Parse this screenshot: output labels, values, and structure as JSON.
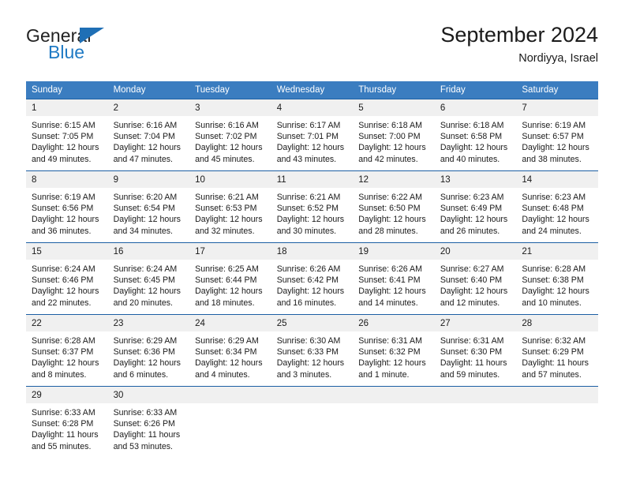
{
  "logo": {
    "word_one": "General",
    "word_two": "Blue",
    "triangle_color": "#1f6fb5",
    "blue_color": "#1f7ac4"
  },
  "header": {
    "title": "September 2024",
    "location": "Nordiyya, Israel"
  },
  "theme": {
    "header_row_bg": "#3b7dc0",
    "week_separator": "#1c5fa4",
    "daynum_bg": "#f0f0f0",
    "page_bg": "#ffffff"
  },
  "weekday_headers": [
    "Sunday",
    "Monday",
    "Tuesday",
    "Wednesday",
    "Thursday",
    "Friday",
    "Saturday"
  ],
  "labels": {
    "sunrise_prefix": "Sunrise:",
    "sunset_prefix": "Sunset:",
    "daylight_prefix": "Daylight:"
  },
  "weeks": [
    [
      {
        "day": "1",
        "sunrise": "Sunrise: 6:15 AM",
        "sunset": "Sunset: 7:05 PM",
        "daylight_line1": "Daylight: 12 hours",
        "daylight_line2": "and 49 minutes."
      },
      {
        "day": "2",
        "sunrise": "Sunrise: 6:16 AM",
        "sunset": "Sunset: 7:04 PM",
        "daylight_line1": "Daylight: 12 hours",
        "daylight_line2": "and 47 minutes."
      },
      {
        "day": "3",
        "sunrise": "Sunrise: 6:16 AM",
        "sunset": "Sunset: 7:02 PM",
        "daylight_line1": "Daylight: 12 hours",
        "daylight_line2": "and 45 minutes."
      },
      {
        "day": "4",
        "sunrise": "Sunrise: 6:17 AM",
        "sunset": "Sunset: 7:01 PM",
        "daylight_line1": "Daylight: 12 hours",
        "daylight_line2": "and 43 minutes."
      },
      {
        "day": "5",
        "sunrise": "Sunrise: 6:18 AM",
        "sunset": "Sunset: 7:00 PM",
        "daylight_line1": "Daylight: 12 hours",
        "daylight_line2": "and 42 minutes."
      },
      {
        "day": "6",
        "sunrise": "Sunrise: 6:18 AM",
        "sunset": "Sunset: 6:58 PM",
        "daylight_line1": "Daylight: 12 hours",
        "daylight_line2": "and 40 minutes."
      },
      {
        "day": "7",
        "sunrise": "Sunrise: 6:19 AM",
        "sunset": "Sunset: 6:57 PM",
        "daylight_line1": "Daylight: 12 hours",
        "daylight_line2": "and 38 minutes."
      }
    ],
    [
      {
        "day": "8",
        "sunrise": "Sunrise: 6:19 AM",
        "sunset": "Sunset: 6:56 PM",
        "daylight_line1": "Daylight: 12 hours",
        "daylight_line2": "and 36 minutes."
      },
      {
        "day": "9",
        "sunrise": "Sunrise: 6:20 AM",
        "sunset": "Sunset: 6:54 PM",
        "daylight_line1": "Daylight: 12 hours",
        "daylight_line2": "and 34 minutes."
      },
      {
        "day": "10",
        "sunrise": "Sunrise: 6:21 AM",
        "sunset": "Sunset: 6:53 PM",
        "daylight_line1": "Daylight: 12 hours",
        "daylight_line2": "and 32 minutes."
      },
      {
        "day": "11",
        "sunrise": "Sunrise: 6:21 AM",
        "sunset": "Sunset: 6:52 PM",
        "daylight_line1": "Daylight: 12 hours",
        "daylight_line2": "and 30 minutes."
      },
      {
        "day": "12",
        "sunrise": "Sunrise: 6:22 AM",
        "sunset": "Sunset: 6:50 PM",
        "daylight_line1": "Daylight: 12 hours",
        "daylight_line2": "and 28 minutes."
      },
      {
        "day": "13",
        "sunrise": "Sunrise: 6:23 AM",
        "sunset": "Sunset: 6:49 PM",
        "daylight_line1": "Daylight: 12 hours",
        "daylight_line2": "and 26 minutes."
      },
      {
        "day": "14",
        "sunrise": "Sunrise: 6:23 AM",
        "sunset": "Sunset: 6:48 PM",
        "daylight_line1": "Daylight: 12 hours",
        "daylight_line2": "and 24 minutes."
      }
    ],
    [
      {
        "day": "15",
        "sunrise": "Sunrise: 6:24 AM",
        "sunset": "Sunset: 6:46 PM",
        "daylight_line1": "Daylight: 12 hours",
        "daylight_line2": "and 22 minutes."
      },
      {
        "day": "16",
        "sunrise": "Sunrise: 6:24 AM",
        "sunset": "Sunset: 6:45 PM",
        "daylight_line1": "Daylight: 12 hours",
        "daylight_line2": "and 20 minutes."
      },
      {
        "day": "17",
        "sunrise": "Sunrise: 6:25 AM",
        "sunset": "Sunset: 6:44 PM",
        "daylight_line1": "Daylight: 12 hours",
        "daylight_line2": "and 18 minutes."
      },
      {
        "day": "18",
        "sunrise": "Sunrise: 6:26 AM",
        "sunset": "Sunset: 6:42 PM",
        "daylight_line1": "Daylight: 12 hours",
        "daylight_line2": "and 16 minutes."
      },
      {
        "day": "19",
        "sunrise": "Sunrise: 6:26 AM",
        "sunset": "Sunset: 6:41 PM",
        "daylight_line1": "Daylight: 12 hours",
        "daylight_line2": "and 14 minutes."
      },
      {
        "day": "20",
        "sunrise": "Sunrise: 6:27 AM",
        "sunset": "Sunset: 6:40 PM",
        "daylight_line1": "Daylight: 12 hours",
        "daylight_line2": "and 12 minutes."
      },
      {
        "day": "21",
        "sunrise": "Sunrise: 6:28 AM",
        "sunset": "Sunset: 6:38 PM",
        "daylight_line1": "Daylight: 12 hours",
        "daylight_line2": "and 10 minutes."
      }
    ],
    [
      {
        "day": "22",
        "sunrise": "Sunrise: 6:28 AM",
        "sunset": "Sunset: 6:37 PM",
        "daylight_line1": "Daylight: 12 hours",
        "daylight_line2": "and 8 minutes."
      },
      {
        "day": "23",
        "sunrise": "Sunrise: 6:29 AM",
        "sunset": "Sunset: 6:36 PM",
        "daylight_line1": "Daylight: 12 hours",
        "daylight_line2": "and 6 minutes."
      },
      {
        "day": "24",
        "sunrise": "Sunrise: 6:29 AM",
        "sunset": "Sunset: 6:34 PM",
        "daylight_line1": "Daylight: 12 hours",
        "daylight_line2": "and 4 minutes."
      },
      {
        "day": "25",
        "sunrise": "Sunrise: 6:30 AM",
        "sunset": "Sunset: 6:33 PM",
        "daylight_line1": "Daylight: 12 hours",
        "daylight_line2": "and 3 minutes."
      },
      {
        "day": "26",
        "sunrise": "Sunrise: 6:31 AM",
        "sunset": "Sunset: 6:32 PM",
        "daylight_line1": "Daylight: 12 hours",
        "daylight_line2": "and 1 minute."
      },
      {
        "day": "27",
        "sunrise": "Sunrise: 6:31 AM",
        "sunset": "Sunset: 6:30 PM",
        "daylight_line1": "Daylight: 11 hours",
        "daylight_line2": "and 59 minutes."
      },
      {
        "day": "28",
        "sunrise": "Sunrise: 6:32 AM",
        "sunset": "Sunset: 6:29 PM",
        "daylight_line1": "Daylight: 11 hours",
        "daylight_line2": "and 57 minutes."
      }
    ],
    [
      {
        "day": "29",
        "sunrise": "Sunrise: 6:33 AM",
        "sunset": "Sunset: 6:28 PM",
        "daylight_line1": "Daylight: 11 hours",
        "daylight_line2": "and 55 minutes."
      },
      {
        "day": "30",
        "sunrise": "Sunrise: 6:33 AM",
        "sunset": "Sunset: 6:26 PM",
        "daylight_line1": "Daylight: 11 hours",
        "daylight_line2": "and 53 minutes."
      },
      {
        "day": "",
        "sunrise": "",
        "sunset": "",
        "daylight_line1": "",
        "daylight_line2": ""
      },
      {
        "day": "",
        "sunrise": "",
        "sunset": "",
        "daylight_line1": "",
        "daylight_line2": ""
      },
      {
        "day": "",
        "sunrise": "",
        "sunset": "",
        "daylight_line1": "",
        "daylight_line2": ""
      },
      {
        "day": "",
        "sunrise": "",
        "sunset": "",
        "daylight_line1": "",
        "daylight_line2": ""
      },
      {
        "day": "",
        "sunrise": "",
        "sunset": "",
        "daylight_line1": "",
        "daylight_line2": ""
      }
    ]
  ]
}
